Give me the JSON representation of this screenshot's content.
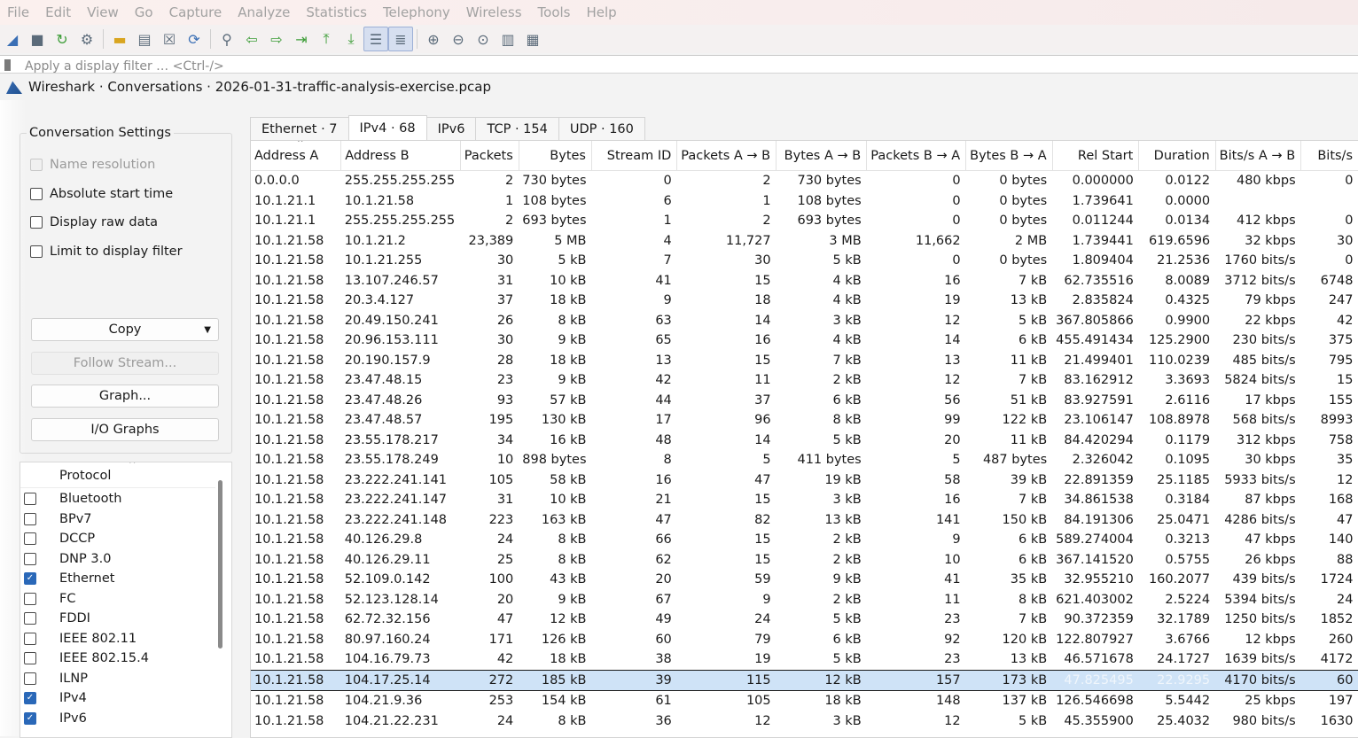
{
  "menubar": {
    "items": [
      "File",
      "Edit",
      "View",
      "Go",
      "Capture",
      "Analyze",
      "Statistics",
      "Telephony",
      "Wireless",
      "Tools",
      "Help"
    ]
  },
  "toolbar": {
    "icons": [
      "shark-fin-start-icon",
      "stop-capture-icon",
      "restart-capture-icon",
      "capture-options-icon",
      "open-file-icon",
      "save-file-icon",
      "close-file-icon",
      "reload-file-icon",
      "find-packet-icon",
      "go-back-icon",
      "go-forward-icon",
      "go-to-packet-icon",
      "go-first-icon",
      "go-last-icon",
      "auto-scroll-icon",
      "colorize-icon",
      "zoom-in-icon",
      "zoom-out-icon",
      "normal-size-icon",
      "resize-columns-icon",
      "layout-icon"
    ]
  },
  "filterbar": {
    "placeholder": "Apply a display filter … <Ctrl-/>"
  },
  "dialog": {
    "title": "Wireshark · Conversations · 2026-01-31-traffic-analysis-exercise.pcap",
    "settings": {
      "title": "Conversation Settings",
      "name_resolution": "Name resolution",
      "absolute_start_time": "Absolute start time",
      "display_raw_data": "Display raw data",
      "limit_to_display_filter": "Limit to display filter"
    },
    "buttons": {
      "copy": "Copy",
      "follow_stream": "Follow Stream...",
      "graph": "Graph...",
      "io_graphs": "I/O Graphs"
    },
    "protocol_list": {
      "header": "Protocol",
      "items": [
        {
          "name": "Bluetooth",
          "checked": false
        },
        {
          "name": "BPv7",
          "checked": false
        },
        {
          "name": "DCCP",
          "checked": false
        },
        {
          "name": "DNP 3.0",
          "checked": false
        },
        {
          "name": "Ethernet",
          "checked": true
        },
        {
          "name": "FC",
          "checked": false
        },
        {
          "name": "FDDI",
          "checked": false
        },
        {
          "name": "IEEE 802.11",
          "checked": false
        },
        {
          "name": "IEEE 802.15.4",
          "checked": false
        },
        {
          "name": "ILNP",
          "checked": false
        },
        {
          "name": "IPv4",
          "checked": true
        },
        {
          "name": "IPv6",
          "checked": true
        }
      ]
    },
    "tabs": [
      "Ethernet · 7",
      "IPv4 · 68",
      "IPv6",
      "TCP · 154",
      "UDP · 160"
    ],
    "active_tab": 1,
    "table": {
      "columns": [
        "Address A",
        "Address B",
        "Packets",
        "Bytes",
        "Stream ID",
        "Packets A → B",
        "Bytes A → B",
        "Packets B → A",
        "Bytes B → A",
        "Rel Start",
        "Duration",
        "Bits/s A → B",
        "Bits/s"
      ],
      "rows": [
        [
          "0.0.0.0",
          "255.255.255.255",
          "2",
          "730 bytes",
          "0",
          "2",
          "730 bytes",
          "0",
          "0 bytes",
          "0.000000",
          "0.0122",
          "480 kbps",
          "0"
        ],
        [
          "10.1.21.1",
          "10.1.21.58",
          "1",
          "108 bytes",
          "6",
          "1",
          "108 bytes",
          "0",
          "0 bytes",
          "1.739641",
          "0.0000",
          "",
          ""
        ],
        [
          "10.1.21.1",
          "255.255.255.255",
          "2",
          "693 bytes",
          "1",
          "2",
          "693 bytes",
          "0",
          "0 bytes",
          "0.011244",
          "0.0134",
          "412 kbps",
          "0"
        ],
        [
          "10.1.21.58",
          "10.1.21.2",
          "23,389",
          "5 MB",
          "4",
          "11,727",
          "3 MB",
          "11,662",
          "2 MB",
          "1.739441",
          "619.6596",
          "32 kbps",
          "30"
        ],
        [
          "10.1.21.58",
          "10.1.21.255",
          "30",
          "5 kB",
          "7",
          "30",
          "5 kB",
          "0",
          "0 bytes",
          "1.809404",
          "21.2536",
          "1760 bits/s",
          "0"
        ],
        [
          "10.1.21.58",
          "13.107.246.57",
          "31",
          "10 kB",
          "41",
          "15",
          "4 kB",
          "16",
          "7 kB",
          "62.735516",
          "8.0089",
          "3712 bits/s",
          "6748"
        ],
        [
          "10.1.21.58",
          "20.3.4.127",
          "37",
          "18 kB",
          "9",
          "18",
          "4 kB",
          "19",
          "13 kB",
          "2.835824",
          "0.4325",
          "79 kbps",
          "247"
        ],
        [
          "10.1.21.58",
          "20.49.150.241",
          "26",
          "8 kB",
          "63",
          "14",
          "3 kB",
          "12",
          "5 kB",
          "367.805866",
          "0.9900",
          "22 kbps",
          "42"
        ],
        [
          "10.1.21.58",
          "20.96.153.111",
          "30",
          "9 kB",
          "65",
          "16",
          "4 kB",
          "14",
          "6 kB",
          "455.491434",
          "125.2900",
          "230 bits/s",
          "375"
        ],
        [
          "10.1.21.58",
          "20.190.157.9",
          "28",
          "18 kB",
          "13",
          "15",
          "7 kB",
          "13",
          "11 kB",
          "21.499401",
          "110.0239",
          "485 bits/s",
          "795"
        ],
        [
          "10.1.21.58",
          "23.47.48.15",
          "23",
          "9 kB",
          "42",
          "11",
          "2 kB",
          "12",
          "7 kB",
          "83.162912",
          "3.3693",
          "5824 bits/s",
          "15"
        ],
        [
          "10.1.21.58",
          "23.47.48.26",
          "93",
          "57 kB",
          "44",
          "37",
          "6 kB",
          "56",
          "51 kB",
          "83.927591",
          "2.6116",
          "17 kbps",
          "155"
        ],
        [
          "10.1.21.58",
          "23.47.48.57",
          "195",
          "130 kB",
          "17",
          "96",
          "8 kB",
          "99",
          "122 kB",
          "23.106147",
          "108.8978",
          "568 bits/s",
          "8993"
        ],
        [
          "10.1.21.58",
          "23.55.178.217",
          "34",
          "16 kB",
          "48",
          "14",
          "5 kB",
          "20",
          "11 kB",
          "84.420294",
          "0.1179",
          "312 kbps",
          "758"
        ],
        [
          "10.1.21.58",
          "23.55.178.249",
          "10",
          "898 bytes",
          "8",
          "5",
          "411 bytes",
          "5",
          "487 bytes",
          "2.326042",
          "0.1095",
          "30 kbps",
          "35"
        ],
        [
          "10.1.21.58",
          "23.222.241.141",
          "105",
          "58 kB",
          "16",
          "47",
          "19 kB",
          "58",
          "39 kB",
          "22.891359",
          "25.1185",
          "5933 bits/s",
          "12"
        ],
        [
          "10.1.21.58",
          "23.222.241.147",
          "31",
          "10 kB",
          "21",
          "15",
          "3 kB",
          "16",
          "7 kB",
          "34.861538",
          "0.3184",
          "87 kbps",
          "168"
        ],
        [
          "10.1.21.58",
          "23.222.241.148",
          "223",
          "163 kB",
          "47",
          "82",
          "13 kB",
          "141",
          "150 kB",
          "84.191306",
          "25.0471",
          "4286 bits/s",
          "47"
        ],
        [
          "10.1.21.58",
          "40.126.29.8",
          "24",
          "8 kB",
          "66",
          "15",
          "2 kB",
          "9",
          "6 kB",
          "589.274004",
          "0.3213",
          "47 kbps",
          "140"
        ],
        [
          "10.1.21.58",
          "40.126.29.11",
          "25",
          "8 kB",
          "62",
          "15",
          "2 kB",
          "10",
          "6 kB",
          "367.141520",
          "0.5755",
          "26 kbps",
          "88"
        ],
        [
          "10.1.21.58",
          "52.109.0.142",
          "100",
          "43 kB",
          "20",
          "59",
          "9 kB",
          "41",
          "35 kB",
          "32.955210",
          "160.2077",
          "439 bits/s",
          "1724"
        ],
        [
          "10.1.21.58",
          "52.123.128.14",
          "20",
          "9 kB",
          "67",
          "9",
          "2 kB",
          "11",
          "8 kB",
          "621.403002",
          "2.5224",
          "5394 bits/s",
          "24"
        ],
        [
          "10.1.21.58",
          "62.72.32.156",
          "47",
          "12 kB",
          "49",
          "24",
          "5 kB",
          "23",
          "7 kB",
          "90.372359",
          "32.1789",
          "1250 bits/s",
          "1852"
        ],
        [
          "10.1.21.58",
          "80.97.160.24",
          "171",
          "126 kB",
          "60",
          "79",
          "6 kB",
          "92",
          "120 kB",
          "122.807927",
          "3.6766",
          "12 kbps",
          "260"
        ],
        [
          "10.1.21.58",
          "104.16.79.73",
          "42",
          "18 kB",
          "38",
          "19",
          "5 kB",
          "23",
          "13 kB",
          "46.571678",
          "24.1727",
          "1639 bits/s",
          "4172"
        ],
        [
          "10.1.21.58",
          "104.17.25.14",
          "272",
          "185 kB",
          "39",
          "115",
          "12 kB",
          "157",
          "173 kB",
          "47.825495",
          "22.9295",
          "4170 bits/s",
          "60"
        ],
        [
          "10.1.21.58",
          "104.21.9.36",
          "253",
          "154 kB",
          "61",
          "105",
          "18 kB",
          "148",
          "137 kB",
          "126.546698",
          "5.5442",
          "25 kbps",
          "197"
        ],
        [
          "10.1.21.58",
          "104.21.22.231",
          "24",
          "8 kB",
          "36",
          "12",
          "3 kB",
          "12",
          "5 kB",
          "45.355900",
          "25.4032",
          "980 bits/s",
          "1630"
        ]
      ],
      "selected_row": 25
    }
  }
}
